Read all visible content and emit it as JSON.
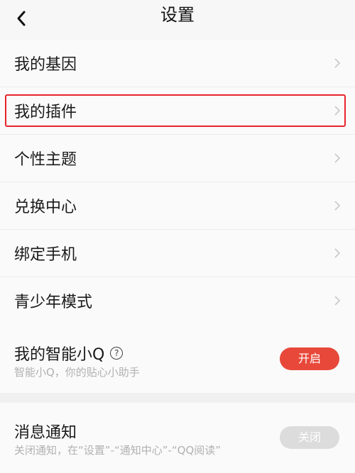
{
  "header": {
    "title": "设置",
    "back_icon": "chevron-left-icon"
  },
  "menu": {
    "items": [
      {
        "label": "我的基因"
      },
      {
        "label": "我的插件",
        "highlighted": true
      },
      {
        "label": "个性主题"
      },
      {
        "label": "兑换中心"
      },
      {
        "label": "绑定手机"
      },
      {
        "label": "青少年模式"
      }
    ]
  },
  "smart_q": {
    "label": "我的智能小Q",
    "help_icon": "?",
    "subtitle": "智能小Q，你的贴心小助手",
    "button_label": "开启"
  },
  "notifications": {
    "label": "消息通知",
    "subtitle": "关闭通知，在“设置”-“通知中心”-“QQ阅读”",
    "button_label": "关闭"
  },
  "colors": {
    "accent": "#e8483a",
    "highlight_border": "#e8242c",
    "background": "#f7f7f7"
  }
}
